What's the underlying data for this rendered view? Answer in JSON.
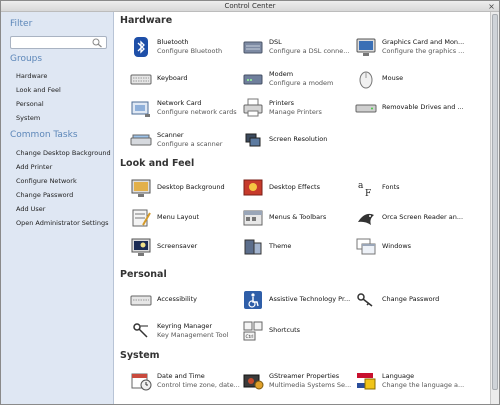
{
  "window": {
    "title": "Control Center"
  },
  "sidebar": {
    "filter_heading": "Filter",
    "search_value": "",
    "groups_heading": "Groups",
    "groups": [
      "Hardware",
      "Look and Feel",
      "Personal",
      "System"
    ],
    "tasks_heading": "Common Tasks",
    "tasks": [
      "Change Desktop Background",
      "Add Printer",
      "Configure Network",
      "Change Password",
      "Add User",
      "Open Administrator Settings"
    ]
  },
  "sections": [
    {
      "title": "Hardware",
      "items": [
        {
          "name": "Bluetooth",
          "desc": "Configure Bluetooth",
          "icon": "bluetooth-icon"
        },
        {
          "name": "DSL",
          "desc": "Configure a DSL conne...",
          "icon": "dsl-modem-icon"
        },
        {
          "name": "Graphics Card and Mon...",
          "desc": "Configure the graphics ...",
          "icon": "monitor-icon"
        },
        {
          "name": "Keyboard",
          "desc": "",
          "icon": "keyboard-icon"
        },
        {
          "name": "Modem",
          "desc": "Configure a modem",
          "icon": "modem-icon"
        },
        {
          "name": "Mouse",
          "desc": "",
          "icon": "mouse-icon"
        },
        {
          "name": "Network Card",
          "desc": "Configure network cards",
          "icon": "network-card-icon"
        },
        {
          "name": "Printers",
          "desc": "Manage Printers",
          "icon": "printer-icon"
        },
        {
          "name": "Removable Drives and ...",
          "desc": "",
          "icon": "removable-drive-icon"
        },
        {
          "name": "Scanner",
          "desc": "Configure a scanner",
          "icon": "scanner-icon"
        },
        {
          "name": "Screen Resolution",
          "desc": "",
          "icon": "screen-resolution-icon"
        }
      ]
    },
    {
      "title": "Look and Feel",
      "items": [
        {
          "name": "Desktop Background",
          "desc": "",
          "icon": "desktop-background-icon"
        },
        {
          "name": "Desktop Effects",
          "desc": "",
          "icon": "desktop-effects-icon"
        },
        {
          "name": "Fonts",
          "desc": "",
          "icon": "fonts-icon"
        },
        {
          "name": "Menu Layout",
          "desc": "",
          "icon": "menu-layout-icon"
        },
        {
          "name": "Menus & Toolbars",
          "desc": "",
          "icon": "menus-toolbars-icon"
        },
        {
          "name": "Orca Screen Reader an...",
          "desc": "",
          "icon": "orca-icon"
        },
        {
          "name": "Screensaver",
          "desc": "",
          "icon": "screensaver-icon"
        },
        {
          "name": "Theme",
          "desc": "",
          "icon": "theme-icon"
        },
        {
          "name": "Windows",
          "desc": "",
          "icon": "windows-icon"
        }
      ]
    },
    {
      "title": "Personal",
      "items": [
        {
          "name": "Accessibility",
          "desc": "",
          "icon": "accessibility-keyboard-icon"
        },
        {
          "name": "Assistive Technology Pr...",
          "desc": "",
          "icon": "assistive-technology-icon"
        },
        {
          "name": "Change Password",
          "desc": "",
          "icon": "keys-icon"
        },
        {
          "name": "Keyring Manager",
          "desc": "Key Management Tool",
          "icon": "keyring-icon"
        },
        {
          "name": "Shortcuts",
          "desc": "",
          "icon": "shortcuts-icon"
        }
      ]
    },
    {
      "title": "System",
      "items": [
        {
          "name": "Date and Time",
          "desc": "Control time zone, date...",
          "icon": "date-time-icon"
        },
        {
          "name": "GStreamer Properties",
          "desc": "Multimedia Systems Se...",
          "icon": "gstreamer-icon"
        },
        {
          "name": "Language",
          "desc": "Change the language a...",
          "icon": "language-flag-icon"
        }
      ]
    }
  ]
}
